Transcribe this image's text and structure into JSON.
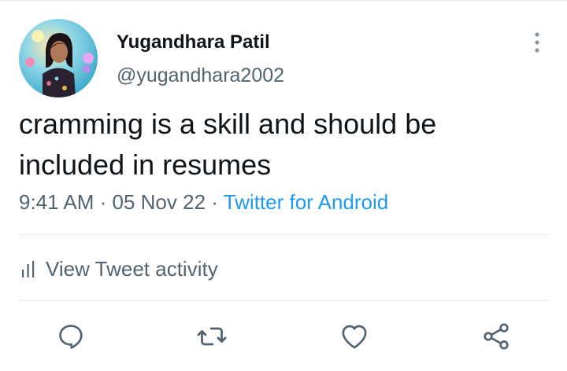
{
  "author": {
    "display_name": "Yugandhara Patil",
    "handle": "@yugandhara2002",
    "avatar_icon": "profile-photo"
  },
  "more_icon": "vertical-ellipsis-icon",
  "tweet": {
    "text": "cramming is a skill and should be included in resumes",
    "time": "9:41 AM",
    "sep1": " · ",
    "date": "05 Nov 22",
    "sep2": " · ",
    "source": "Twitter for Android"
  },
  "activity": {
    "label": "View Tweet activity",
    "icon": "bar-chart-icon"
  },
  "actions": [
    {
      "name": "reply",
      "icon": "reply-icon"
    },
    {
      "name": "retweet",
      "icon": "retweet-icon"
    },
    {
      "name": "like",
      "icon": "heart-icon"
    },
    {
      "name": "share",
      "icon": "share-icon"
    }
  ],
  "colors": {
    "text_primary": "#0f1419",
    "text_secondary": "#536471",
    "link": "#1d9bf0",
    "divider": "#e6ecf0"
  }
}
